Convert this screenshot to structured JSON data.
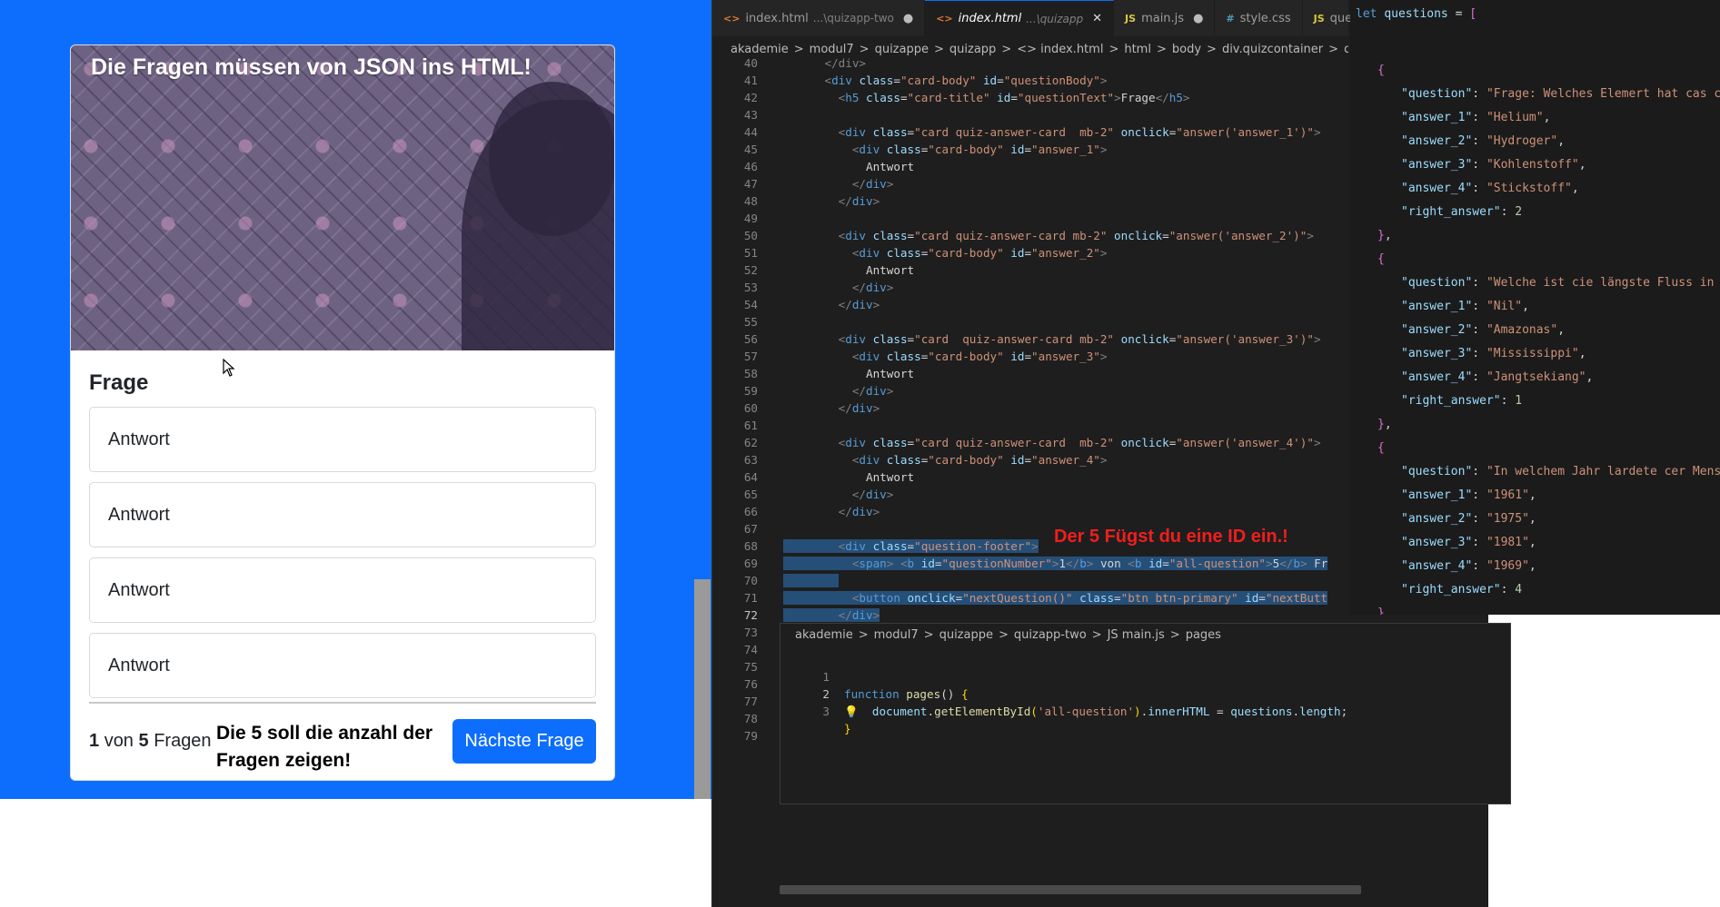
{
  "quiz": {
    "image_title": "Die Fragen müssen von JSON ins HTML!",
    "question": "Frage",
    "answers": [
      "Antwort",
      "Antwort",
      "Antwort",
      "Antwort"
    ],
    "footer": {
      "current": "1",
      "of_word": "von",
      "total": "5",
      "questions_word": "Fragen",
      "note": "Die 5 soll die anzahl der Fragen zeigen!",
      "next_button": "Nächste Frage"
    }
  },
  "editor": {
    "tabs": [
      {
        "icon": "<>",
        "label": "index.html",
        "sub": "...\\quizapp-two",
        "state": "dot"
      },
      {
        "icon": "<>",
        "label": "index.html",
        "sub": "...\\quizapp",
        "state": "close"
      },
      {
        "icon": "JS",
        "label": "main.js",
        "sub": "",
        "state": "dot"
      },
      {
        "icon": "#",
        "label": "style.css",
        "sub": "",
        "state": ""
      },
      {
        "icon": "JS",
        "label": "ques",
        "sub": "",
        "state": ""
      }
    ],
    "breadcrumb": [
      "akademie",
      ">",
      "modul7",
      ">",
      "quizappe",
      ">",
      "quizapp",
      ">",
      "<> index.html",
      ">",
      "html",
      ">",
      "body",
      ">",
      "div.quizcontainer",
      ">",
      "div."
    ],
    "annotation": "Der 5 Fügst du eine ID ein.!",
    "peek": {
      "breadcrumb": [
        "akademie",
        ">",
        "modul7",
        ">",
        "quizappe",
        ">",
        "quizapp-two",
        ">",
        "JS main.js",
        ">",
        "pages"
      ],
      "lines": [
        "1",
        "2",
        "3"
      ]
    }
  },
  "json_panel": {
    "header_kw": "let",
    "header_var": "questions",
    "questions": [
      {
        "question": "Frage: Welches Elemert hat cas chemische",
        "answer_1": "Helium",
        "answer_2": "Hydroger",
        "answer_3": "Kohlenstoff",
        "answer_4": "Stickstoff",
        "right_answer": "2"
      },
      {
        "question": "Welche ist cie längste Fluss in der Welt",
        "answer_1": "Nil",
        "answer_2": "Amazonas",
        "answer_3": "Mississippi",
        "answer_4": "Jangtsekiang",
        "right_answer": "1"
      },
      {
        "question": "In welchem Jahr lardete cer Mensch erstm",
        "answer_1": "1961",
        "answer_2": "1975",
        "answer_3": "1981",
        "answer_4": "1969",
        "right_answer": "4"
      }
    ]
  }
}
